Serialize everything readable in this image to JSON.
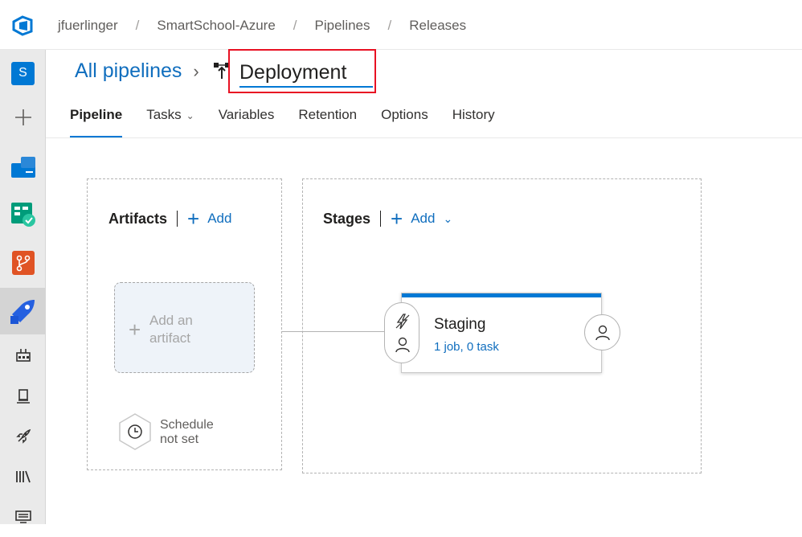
{
  "breadcrumb": [
    "jfuerlinger",
    "SmartSchool-Azure",
    "Pipelines",
    "Releases"
  ],
  "breadcrumb_separator": "/",
  "rail": {
    "project_initial": "S"
  },
  "header": {
    "all_pipelines": "All pipelines",
    "chevron": "›",
    "pipeline_name": "Deployment"
  },
  "tabs": [
    {
      "label": "Pipeline",
      "active": true
    },
    {
      "label": "Tasks",
      "has_dropdown": true
    },
    {
      "label": "Variables"
    },
    {
      "label": "Retention"
    },
    {
      "label": "Options"
    },
    {
      "label": "History"
    }
  ],
  "artifacts": {
    "title": "Artifacts",
    "add_label": "Add",
    "add_artifact_line1": "Add an",
    "add_artifact_line2": "artifact",
    "schedule_line1": "Schedule",
    "schedule_line2": "not set"
  },
  "stages": {
    "title": "Stages",
    "add_label": "Add",
    "stage": {
      "name": "Staging",
      "summary": "1 job, 0 task"
    }
  },
  "colors": {
    "accent": "#0078d4",
    "link": "#106ebe",
    "highlight_box": "#e81123"
  }
}
